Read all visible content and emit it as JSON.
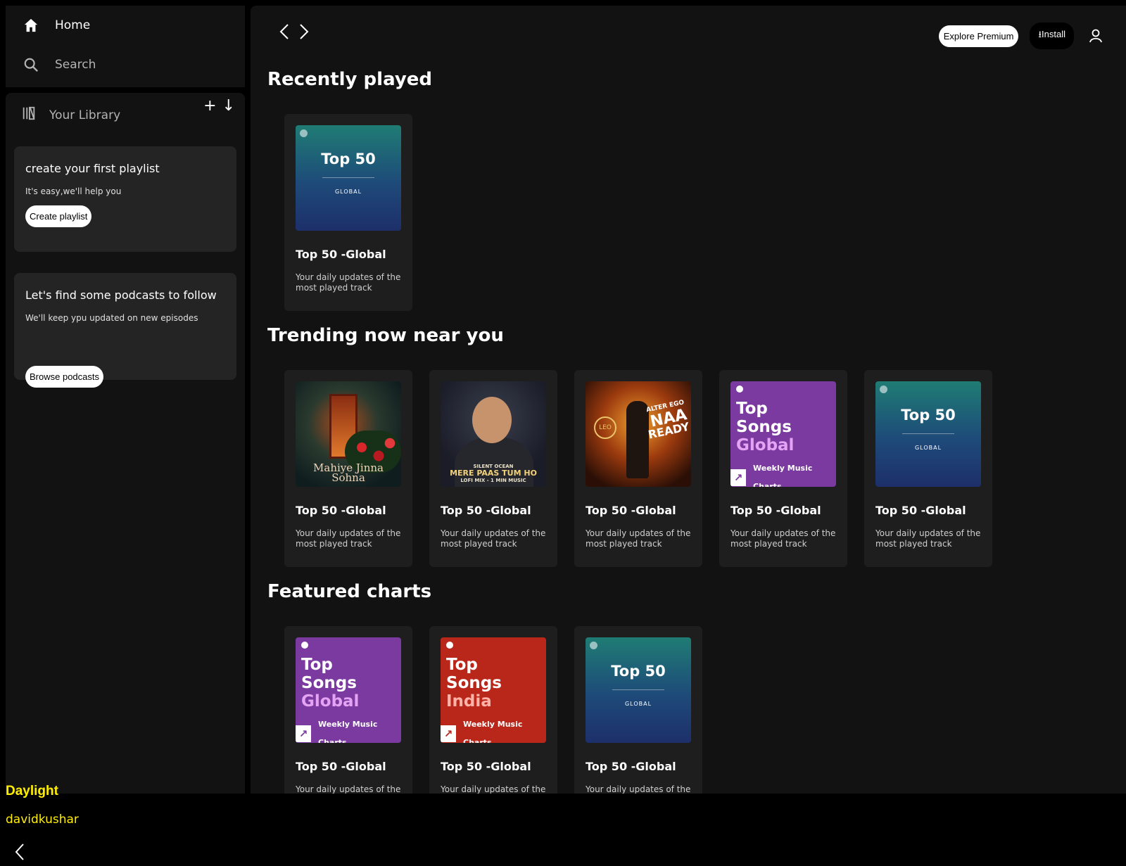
{
  "nav": {
    "home": "Home",
    "search": "Search"
  },
  "library": {
    "title": "Your Library",
    "playlist_card": {
      "heading": "create your first playlist",
      "text": "It's easy,we'll help you",
      "button": "Create playlist"
    },
    "podcast_card": {
      "heading": "Let's find some podcasts to follow",
      "text": "We'll keep ypu updated on new episodes",
      "button": "Browse podcasts"
    }
  },
  "user": {
    "name": "Daylight",
    "handle": "davidkushar"
  },
  "header": {
    "premium": "Explore Premium",
    "install": "Install"
  },
  "sections": [
    {
      "title": "Recently played"
    },
    {
      "title": "Trending now near you"
    },
    {
      "title": "Featured charts"
    }
  ],
  "tile": {
    "title": "Top 50 -Global",
    "subtitle": "Your daily updates of the most played track"
  },
  "art": {
    "top50": {
      "title": "Top 50",
      "sub": "GLOBAL"
    },
    "songs_global": {
      "l1": "Top",
      "l2": "Songs",
      "l3": "Global",
      "badge": "Weekly Music Charts"
    },
    "songs_india": {
      "l1": "Top",
      "l2": "Songs",
      "l3": "India",
      "badge": "Weekly Music Charts"
    },
    "mahiye": {
      "l1": "Mahiye Jinna",
      "l2": "Sohna"
    },
    "mere": {
      "top": "SILENT OCEAN",
      "main": "MERE PAAS TUM HO",
      "sub": "LOFI MIX - 1 MIN MUSIC"
    },
    "leo": {
      "badge": "LEO",
      "text1": "ALTER EGO",
      "text2": "NAA",
      "text3": "READY"
    }
  },
  "colors": {
    "accent_user": "#ffee00",
    "bg": "#121212",
    "card": "#242424"
  }
}
